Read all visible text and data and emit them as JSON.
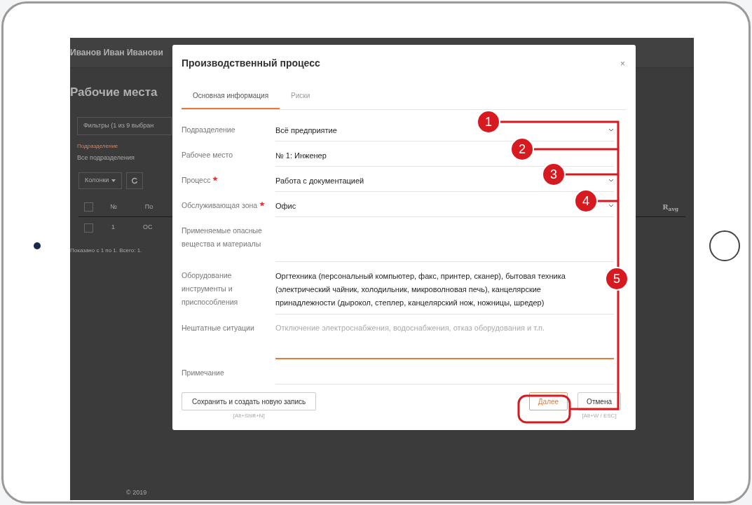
{
  "background": {
    "user": "Иванов Иван Иванови",
    "page_title": "Рабочие места",
    "filters": "Фильтры (1 из 9 выбран",
    "filter_label": "Подразделение",
    "filter_value": "Все подразделения",
    "columns_button": "Колонки",
    "table_headers": [
      "№",
      "По",
      "R$_{avg}$"
    ],
    "header_checkbox": {
      "checked": false
    },
    "row_checkbox": {
      "checked": false
    },
    "row": [
      "1",
      "ОС"
    ],
    "summary": "Показано с 1 по 1. Всего: 1.",
    "footer": "© 2019"
  },
  "modal": {
    "title": "Производственный процесс",
    "close": "×",
    "tabs": [
      {
        "label": "Основная информация",
        "selected": true
      },
      {
        "label": "Риски",
        "selected": false
      }
    ],
    "fields": [
      {
        "label": "Подразделение",
        "required": false,
        "kind": "select",
        "value": "Всё предприятие",
        "focused": false
      },
      {
        "label": "Рабочее место",
        "required": false,
        "kind": "text",
        "value": "№ 1: Инженер",
        "focused": false
      },
      {
        "label": "Процесс",
        "required": true,
        "kind": "select",
        "value": "Работа с документацией",
        "focused": false
      },
      {
        "label": "Обслуживающая зона",
        "required": true,
        "kind": "select",
        "value": "Офис",
        "focused": false
      },
      {
        "label": "Применяемые опасные вещества и материалы",
        "required": false,
        "kind": "multiline",
        "focused": false
      },
      {
        "label": "Оборудование инструменты и приспособления",
        "required": false,
        "kind": "multiline",
        "value": "Оргтехника (персональный компьютер, факс, принтер, сканер), бытовая техника (электрический чайник, холодильник, микроволновая печь), канцелярские принадлежности (дырокол, степлер, канцелярский нож, ножницы, шредер)",
        "focused": false
      },
      {
        "label": "Нештатные ситуации",
        "required": false,
        "kind": "multiline",
        "placeholder": "Отключение электроснабжения, водоснабжения, отказ оборудования и т.п.",
        "focused": true
      },
      {
        "label": "Примечание",
        "required": false,
        "kind": "text",
        "focused": false
      }
    ],
    "save_button": {
      "label": "Сохранить и создать новую запись",
      "hotkey": "[Alt+Shift+N]"
    },
    "next_button": {
      "label": "Далее"
    },
    "cancel_button": {
      "label": "Отмена",
      "hotkey": "[Alt+W / ESC]"
    }
  },
  "annotations": [
    "1",
    "2",
    "3",
    "4",
    "5"
  ]
}
